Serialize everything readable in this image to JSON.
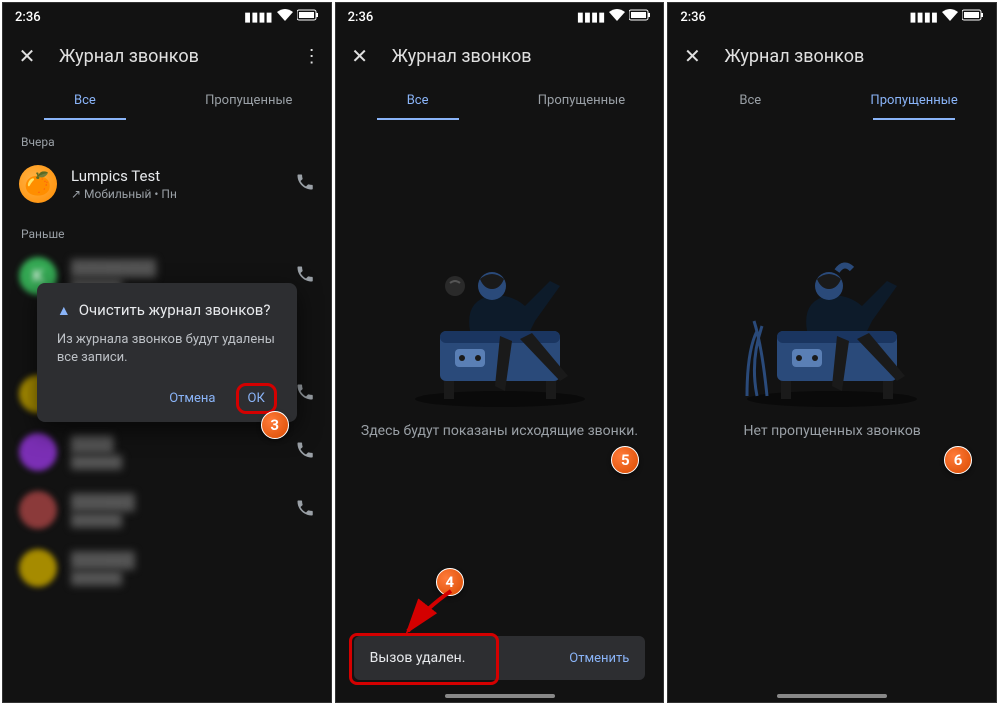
{
  "status": {
    "time": "2:36"
  },
  "app_bar": {
    "title": "Журнал звонков"
  },
  "tabs": {
    "all": "Все",
    "missed": "Пропущенные"
  },
  "sections": {
    "yesterday": "Вчера",
    "earlier": "Раньше"
  },
  "calls": [
    {
      "name": "Lumpics Test",
      "detail": "↗ Мобильный • Пн"
    }
  ],
  "dialog": {
    "title": "Очистить журнал звонков?",
    "body": "Из журнала звонков будут удалены все записи.",
    "cancel": "Отмена",
    "ok": "ОК"
  },
  "empty": {
    "all": "Здесь будут показаны исходящие звонки.",
    "missed": "Нет пропущенных звонков"
  },
  "snackbar": {
    "text": "Вызов удален.",
    "action": "Отменить"
  },
  "badges": {
    "b3": "3",
    "b4": "4",
    "b5": "5",
    "b6": "6"
  }
}
